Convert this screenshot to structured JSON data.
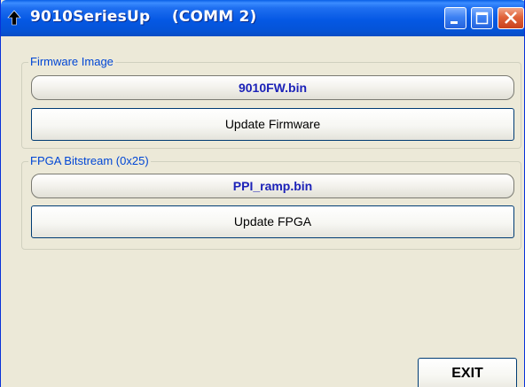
{
  "window": {
    "title": "9010SeriesUp",
    "comm_port": "(COMM 2)",
    "app_icon": "up-arrow-icon"
  },
  "firmware_group": {
    "label": "Firmware Image",
    "file_name": "9010FW.bin",
    "button_label": "Update Firmware"
  },
  "fpga_group": {
    "label": "FPGA Bitstream (0x25)",
    "file_name": "PPI_ramp.bin",
    "button_label": "Update FPGA"
  },
  "exit_button": {
    "label": "EXIT"
  },
  "colors": {
    "titlebar": "#0558e4",
    "group_label": "#0046d5",
    "file_name_text": "#1c22b8",
    "window_face": "#ece9d8"
  }
}
